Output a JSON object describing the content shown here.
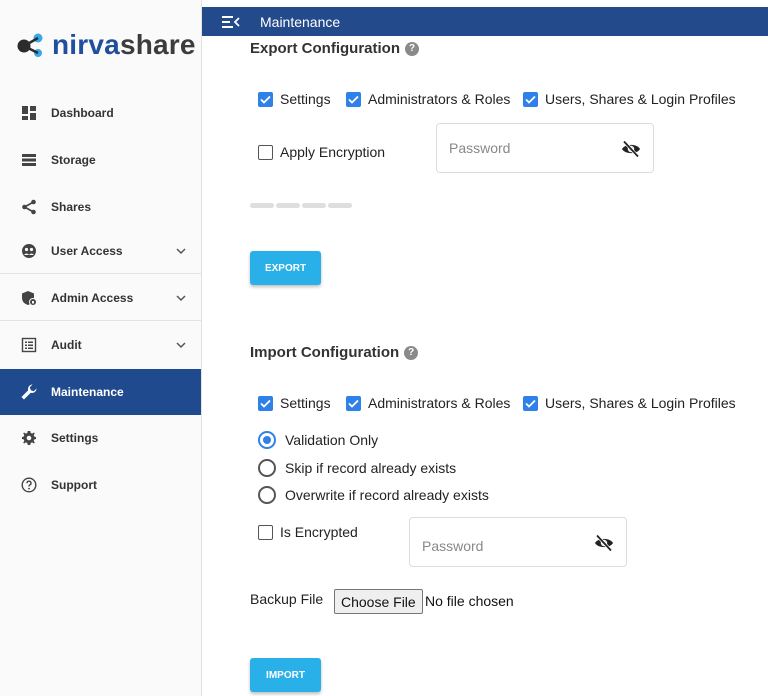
{
  "brand": {
    "name_part1": "nirva",
    "name_part2": "share"
  },
  "header": {
    "title": "Maintenance"
  },
  "sidebar": {
    "items": [
      {
        "label": "Dashboard",
        "icon": "dashboard-icon"
      },
      {
        "label": "Storage",
        "icon": "storage-icon"
      },
      {
        "label": "Shares",
        "icon": "share-icon"
      },
      {
        "label": "User Access",
        "icon": "user-access-icon",
        "expandable": true
      },
      {
        "label": "Admin Access",
        "icon": "admin-shield-icon",
        "expandable": true
      },
      {
        "label": "Audit",
        "icon": "audit-icon",
        "expandable": true
      },
      {
        "label": "Maintenance",
        "icon": "wrench-icon",
        "active": true
      },
      {
        "label": "Settings",
        "icon": "gear-icon"
      },
      {
        "label": "Support",
        "icon": "help-circle-icon"
      }
    ]
  },
  "export": {
    "title": "Export Configuration",
    "options": [
      {
        "label": "Settings",
        "checked": true
      },
      {
        "label": "Administrators & Roles",
        "checked": true
      },
      {
        "label": "Users, Shares & Login Profiles",
        "checked": true
      }
    ],
    "encryption_label": "Apply Encryption",
    "encryption_checked": false,
    "password_placeholder": "Password",
    "button_label": "EXPORT"
  },
  "import": {
    "title": "Import Configuration",
    "options": [
      {
        "label": "Settings",
        "checked": true
      },
      {
        "label": "Administrators & Roles",
        "checked": true
      },
      {
        "label": "Users, Shares & Login Profiles",
        "checked": true
      }
    ],
    "modes": [
      {
        "label": "Validation Only",
        "selected": true
      },
      {
        "label": "Skip if record already exists",
        "selected": false
      },
      {
        "label": "Overwrite if record already exists",
        "selected": false
      }
    ],
    "encrypted_label": "Is Encrypted",
    "encrypted_checked": false,
    "password_placeholder": "Password",
    "backup_file_label": "Backup File",
    "choose_file_label": "Choose File",
    "file_status": "No file chosen",
    "button_label": "IMPORT"
  },
  "colors": {
    "primary": "#234a8a",
    "active_nav": "#1f4a8e",
    "checkbox": "#2f80e8",
    "action_button": "#2ab0e8"
  }
}
